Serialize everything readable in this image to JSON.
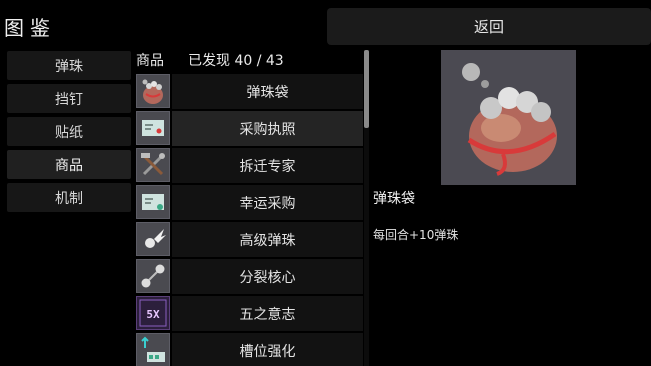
{
  "header": {
    "title": "图鉴",
    "back_label": "返回"
  },
  "categories": [
    {
      "label": "弹珠",
      "active": false
    },
    {
      "label": "挡钉",
      "active": false
    },
    {
      "label": "贴纸",
      "active": false
    },
    {
      "label": "商品",
      "active": true
    },
    {
      "label": "机制",
      "active": false
    }
  ],
  "list": {
    "header_label": "商品",
    "found_text": "已发现 40 / 43",
    "items": [
      {
        "label": "弹珠袋",
        "icon": "marble-bag-icon"
      },
      {
        "label": "采购执照",
        "icon": "license-card-icon"
      },
      {
        "label": "拆迁专家",
        "icon": "hammer-wrench-icon"
      },
      {
        "label": "幸运采购",
        "icon": "lucky-card-icon"
      },
      {
        "label": "高级弹珠",
        "icon": "winged-marble-icon"
      },
      {
        "label": "分裂核心",
        "icon": "split-core-icon"
      },
      {
        "label": "五之意志",
        "icon": "five-will-icon"
      },
      {
        "label": "槽位强化",
        "icon": "slot-upgrade-icon"
      }
    ],
    "selected_index": 1
  },
  "detail": {
    "name": "弹珠袋",
    "description": "每回合+10弹珠",
    "icon": "marble-bag-icon"
  },
  "colors": {
    "background": "#000000",
    "icon_bg": "#4b4a52",
    "bag": "#b3685c",
    "ribbon": "#d83a3a"
  }
}
